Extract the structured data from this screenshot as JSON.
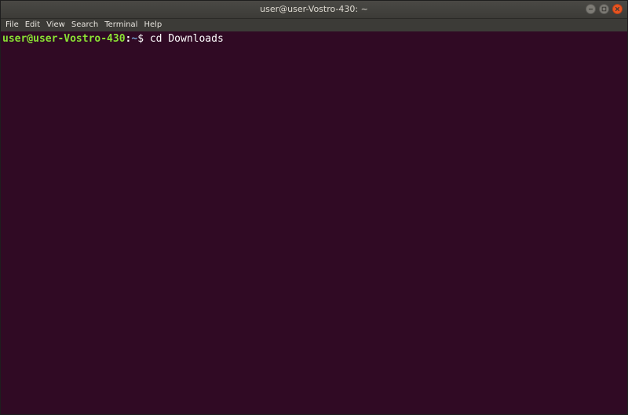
{
  "window": {
    "title": "user@user-Vostro-430: ~"
  },
  "menu": {
    "items": [
      "File",
      "Edit",
      "View",
      "Search",
      "Terminal",
      "Help"
    ]
  },
  "terminal": {
    "prompt_user": "user@user-Vostro-430",
    "prompt_sep": ":",
    "prompt_path": "~",
    "prompt_dollar": "$ ",
    "command": "cd Downloads"
  },
  "colors": {
    "background": "#300a24",
    "prompt_user": "#8ae234",
    "prompt_path": "#729fcf",
    "close_button": "#e95420"
  },
  "icons": {
    "minimize": "minimize-icon",
    "maximize": "maximize-icon",
    "close": "close-icon"
  }
}
